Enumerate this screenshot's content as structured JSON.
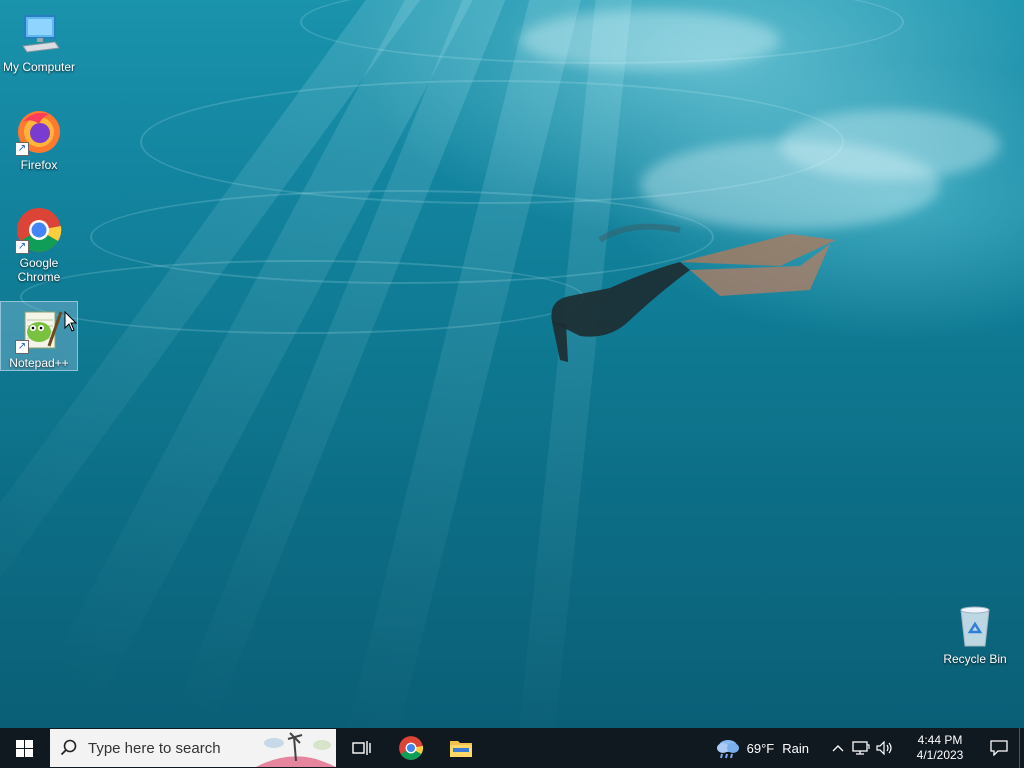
{
  "desktop": {
    "icons": [
      {
        "label": "My Computer",
        "icon": "computer-icon"
      },
      {
        "label": "Firefox",
        "icon": "firefox-icon"
      },
      {
        "label": "Google Chrome",
        "icon": "chrome-icon"
      },
      {
        "label": "Notepad++",
        "icon": "notepadpp-icon"
      }
    ],
    "recycle_bin": {
      "label": "Recycle Bin",
      "icon": "recycle-bin-icon"
    }
  },
  "taskbar": {
    "search_placeholder": "Type here to search",
    "weather": {
      "temp": "69°F",
      "condition": "Rain"
    },
    "clock": {
      "time": "4:44 PM",
      "date": "4/1/2023"
    }
  },
  "colors": {
    "taskbar": "#101820",
    "water": "#0f7a93",
    "selection": "#a0c8e6"
  }
}
